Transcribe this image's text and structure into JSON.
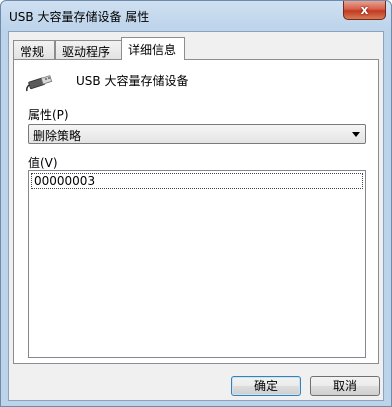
{
  "window": {
    "title": "USB 大容量存储设备 属性",
    "close_label": "x"
  },
  "tabs": [
    {
      "label": "常规"
    },
    {
      "label": "驱动程序"
    },
    {
      "label": "详细信息"
    }
  ],
  "details": {
    "device_name": "USB 大容量存储设备",
    "property_label": "属性(P)",
    "property_value": "删除策略",
    "value_label": "值(V)",
    "values": [
      "00000003"
    ]
  },
  "buttons": {
    "ok": "确定",
    "cancel": "取消"
  }
}
